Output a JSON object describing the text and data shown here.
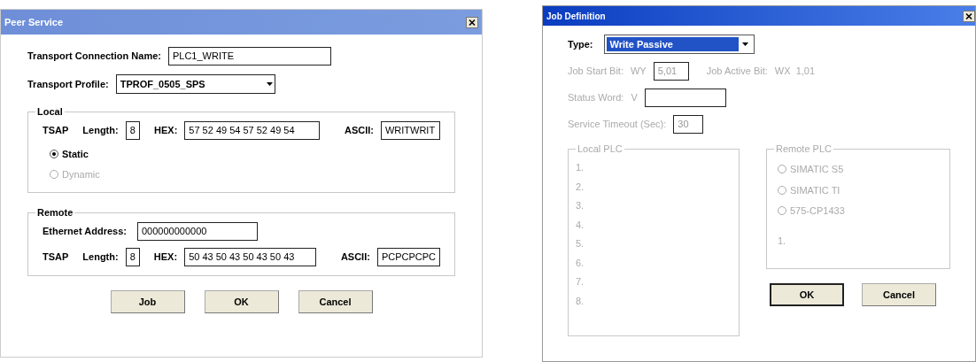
{
  "peer_service": {
    "title": "Peer Service",
    "connection_name": {
      "label": "Transport Connection Name:",
      "value": "PLC1_WRITE"
    },
    "transport_profile": {
      "label": "Transport Profile:",
      "value": "TPROF_0505_SPS"
    },
    "local": {
      "title": "Local",
      "tsap_label": "TSAP",
      "length": {
        "label": "Length:",
        "value": "8"
      },
      "hex": {
        "label": "HEX:",
        "value": "57 52 49 54 57 52 49 54"
      },
      "ascii": {
        "label": "ASCII:",
        "value": "WRITWRIT"
      },
      "modes": [
        {
          "label": "Static",
          "selected": true,
          "disabled": false
        },
        {
          "label": "Dynamic",
          "selected": false,
          "disabled": true
        }
      ]
    },
    "remote": {
      "title": "Remote",
      "ethernet": {
        "label": "Ethernet Address:",
        "value": "000000000000"
      },
      "tsap_label": "TSAP",
      "length": {
        "label": "Length:",
        "value": "8"
      },
      "hex": {
        "label": "HEX:",
        "value": "50 43 50 43 50 43 50 43"
      },
      "ascii": {
        "label": "ASCII:",
        "value": "PCPCPCPC"
      }
    },
    "buttons": [
      "Job",
      "OK",
      "Cancel"
    ]
  },
  "job_definition": {
    "title": "Job Definition",
    "type": {
      "label": "Type:",
      "value": "Write Passive",
      "focused": true
    },
    "details_disabled": true,
    "job_start_bit": {
      "label": "Job Start Bit:",
      "prefix": "WY",
      "value": "5,01"
    },
    "job_active_bit": {
      "label": "Job Active Bit:",
      "value": "WX  1,01"
    },
    "status_word": {
      "label": "Status Word:",
      "prefix": "V"
    },
    "service_timeout": {
      "label": "Service Timeout (Sec):",
      "value": "30"
    },
    "local_plc": {
      "title": "Local PLC",
      "rows": [
        "1.",
        "2.",
        "3.",
        "4.",
        "5.",
        "6.",
        "7.",
        "8."
      ]
    },
    "remote_plc": {
      "title": "Remote PLC",
      "options": [
        {
          "label": "SIMATIC S5",
          "selected": false
        },
        {
          "label": "SIMATIC TI",
          "selected": false
        },
        {
          "label": "575-CP1433",
          "selected": false
        }
      ],
      "row": "1."
    },
    "buttons": [
      {
        "label": "OK",
        "default": true
      },
      {
        "label": "Cancel",
        "default": false
      }
    ]
  }
}
